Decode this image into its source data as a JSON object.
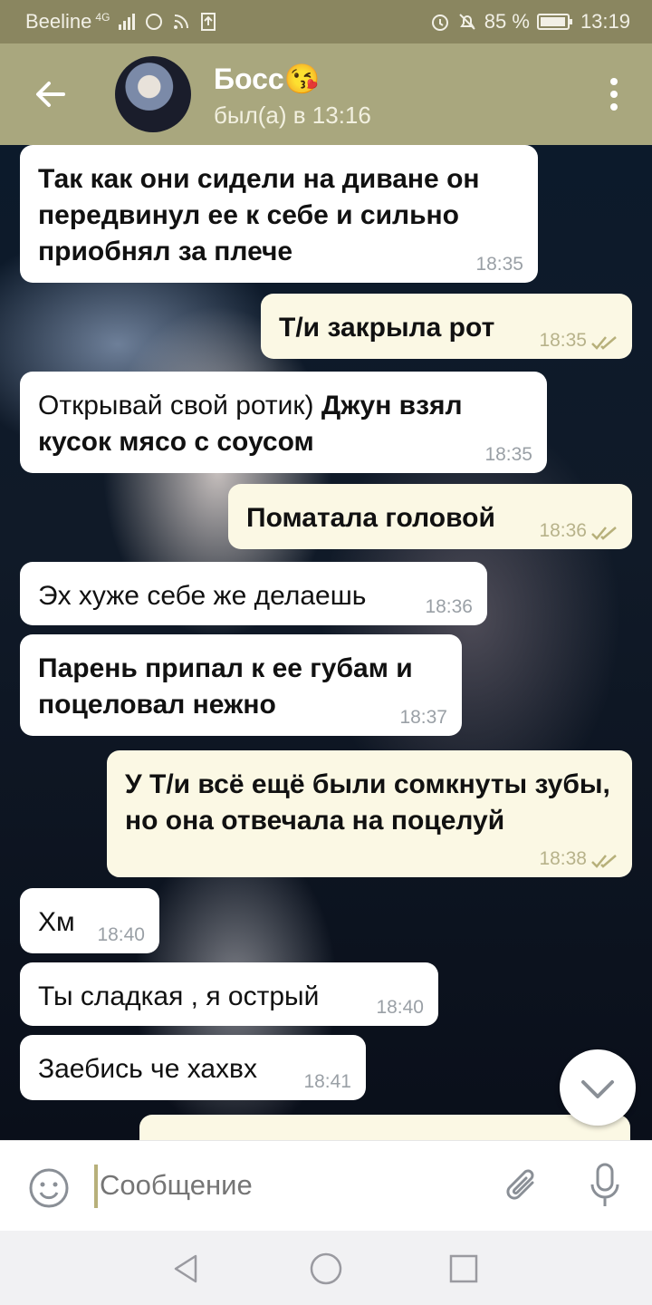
{
  "statusbar": {
    "carrier": "Beeline",
    "network": "4G",
    "battery": "85 %",
    "time": "13:19"
  },
  "header": {
    "title": "Босс😘",
    "status": "был(а) в 13:16"
  },
  "messages": [
    {
      "dir": "in",
      "text": "Так как они сидели на диване он передвинул ее к себе и сильно приобнял за плече",
      "time": "18:35"
    },
    {
      "dir": "out",
      "text": "Т/и закрыла рот",
      "time": "18:35"
    },
    {
      "dir": "in",
      "text_normal": "Открывай свой ротик) ",
      "text_bold": "Джун взял кусок мясо с соусом",
      "time": "18:35"
    },
    {
      "dir": "out",
      "text": "Поматала головой",
      "time": "18:36"
    },
    {
      "dir": "in",
      "text": "Эх хуже себе же делаешь",
      "time": "18:36"
    },
    {
      "dir": "in",
      "text": "Парень припал к ее губам и поцеловал нежно",
      "time": "18:37"
    },
    {
      "dir": "out",
      "text": "У Т/и всё ещё были сомкнуты зубы, но она отвечала на поцелуй",
      "time": "18:38"
    },
    {
      "dir": "in",
      "text": "Хм",
      "time": "18:40"
    },
    {
      "dir": "in",
      "text": "Ты сладкая , я острый",
      "time": "18:40"
    },
    {
      "dir": "in",
      "text": "Заебись че хахвх",
      "time": "18:41"
    }
  ],
  "input": {
    "placeholder": "Сообщение"
  },
  "colors": {
    "header": "#a9a77e",
    "statusbar": "#8a8660",
    "incoming": "#ffffff",
    "outgoing": "#fbf8e4",
    "checks": "#b7b07a"
  }
}
